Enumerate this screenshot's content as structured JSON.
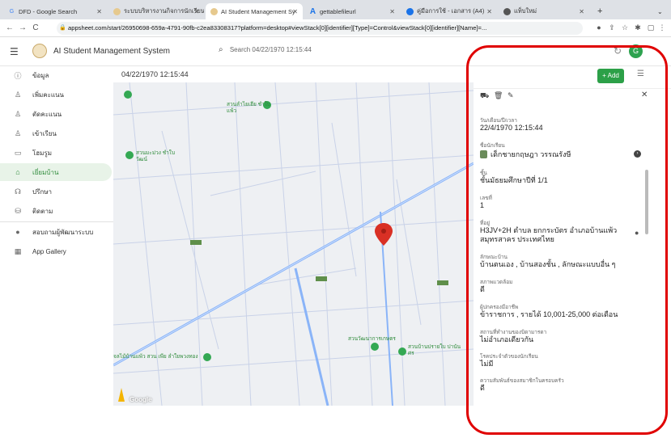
{
  "browser": {
    "tabs": [
      {
        "label": "DFD - Google Search",
        "icon": "google-icon"
      },
      {
        "label": "ระบบบริหารงานกิจการนักเรียน",
        "icon": "app-icon"
      },
      {
        "label": "AI Student Management Sy",
        "icon": "app-icon"
      },
      {
        "label": "gettablefileurl",
        "icon": "drive-icon"
      },
      {
        "label": "คู่มือการใช้ - เอกสาร (A4)",
        "icon": "doc-icon"
      },
      {
        "label": "แท็บใหม่",
        "icon": "chrome-icon"
      }
    ],
    "new_tab": "+",
    "url": "appsheet.com/start/26950698-659a-4791-90fb-c2ea83308317?platform=desktop#viewStack[0][identifier][Type]=Control&viewStack[0][identifier][Name]=..."
  },
  "app": {
    "title": "AI Student Management System",
    "search_placeholder": "Search 04/22/1970 12:15:44",
    "avatar_letter": "G"
  },
  "sidebar": {
    "items": [
      {
        "label": "ข้อมูล",
        "icon": "info-circle-icon"
      },
      {
        "label": "เพิ่มคะแนน",
        "icon": "person-add-icon"
      },
      {
        "label": "ตัดคะแนน",
        "icon": "person-remove-icon"
      },
      {
        "label": "เข้าเรียน",
        "icon": "person-check-icon"
      },
      {
        "label": "โฮมรูม",
        "icon": "classroom-icon"
      },
      {
        "label": "เยี่ยมบ้าน",
        "icon": "home-visit-icon"
      },
      {
        "label": "ปรึกษา",
        "icon": "consult-icon"
      },
      {
        "label": "ติดตาม",
        "icon": "track-icon"
      },
      {
        "label": "สอบถามผู้พัฒนาระบบ",
        "icon": "info-icon"
      },
      {
        "label": "App Gallery",
        "icon": "grid-icon"
      }
    ],
    "active_index": 5
  },
  "map": {
    "header": "04/22/1970 12:15:44",
    "labels": [
      "สวนลำไยเฮีย ชำใบแพ้ว",
      "สวนมะม่วง ชำใบวัฒน์",
      "สวนวัฒนาการเกษตร",
      "สวนบ้านปรายใบ ปานันศร",
      "จลไม้บ้านแพ้ว สวน เพีย ลำใยพวงทอง",
      "Google"
    ]
  },
  "detail": {
    "add_label": "+ Add",
    "fields": [
      {
        "label": "วัน/เดือน/ปี/เวลา",
        "value": "22/4/1970 12:15:44"
      },
      {
        "label": "ชื่อนักเรียน",
        "value": "เด็กชายกฤษฎา วรรณรังษี"
      },
      {
        "label": "ชั้น",
        "value": "ชั้นมัธยมศึกษาปีที่ 1/1"
      },
      {
        "label": "เลขที่",
        "value": "1"
      },
      {
        "label": "ที่อยู่",
        "value": "H3JV+2H ตำบล ยกกระบัตร อำเภอบ้านแพ้ว สมุทรสาคร ประเทศไทย"
      },
      {
        "label": "ลักษณะบ้าน",
        "value": "บ้านตนเอง , บ้านสองชั้น , ลักษณะแบบอื่น ๆ"
      },
      {
        "label": "สภาพแวดล้อม",
        "value": "ดี"
      },
      {
        "label": "ผู้ปกครองมีอาชีพ",
        "value": "ข้าราชการ , รายได้ 10,001-25,000 ต่อเดือน"
      },
      {
        "label": "สถานที่ทำงานของบิดามารดา",
        "value": "ไม่อำเภอเดียวกัน"
      },
      {
        "label": "โรคประจำตัวของนักเรียน",
        "value": "ไม่มี"
      },
      {
        "label": "ความสัมพันธ์ของสมาชิกในครอบครัว",
        "value": "ดี"
      }
    ]
  },
  "colors": {
    "accent": "#2ca048",
    "highlight": "#e00000",
    "pin": "#d93025"
  }
}
